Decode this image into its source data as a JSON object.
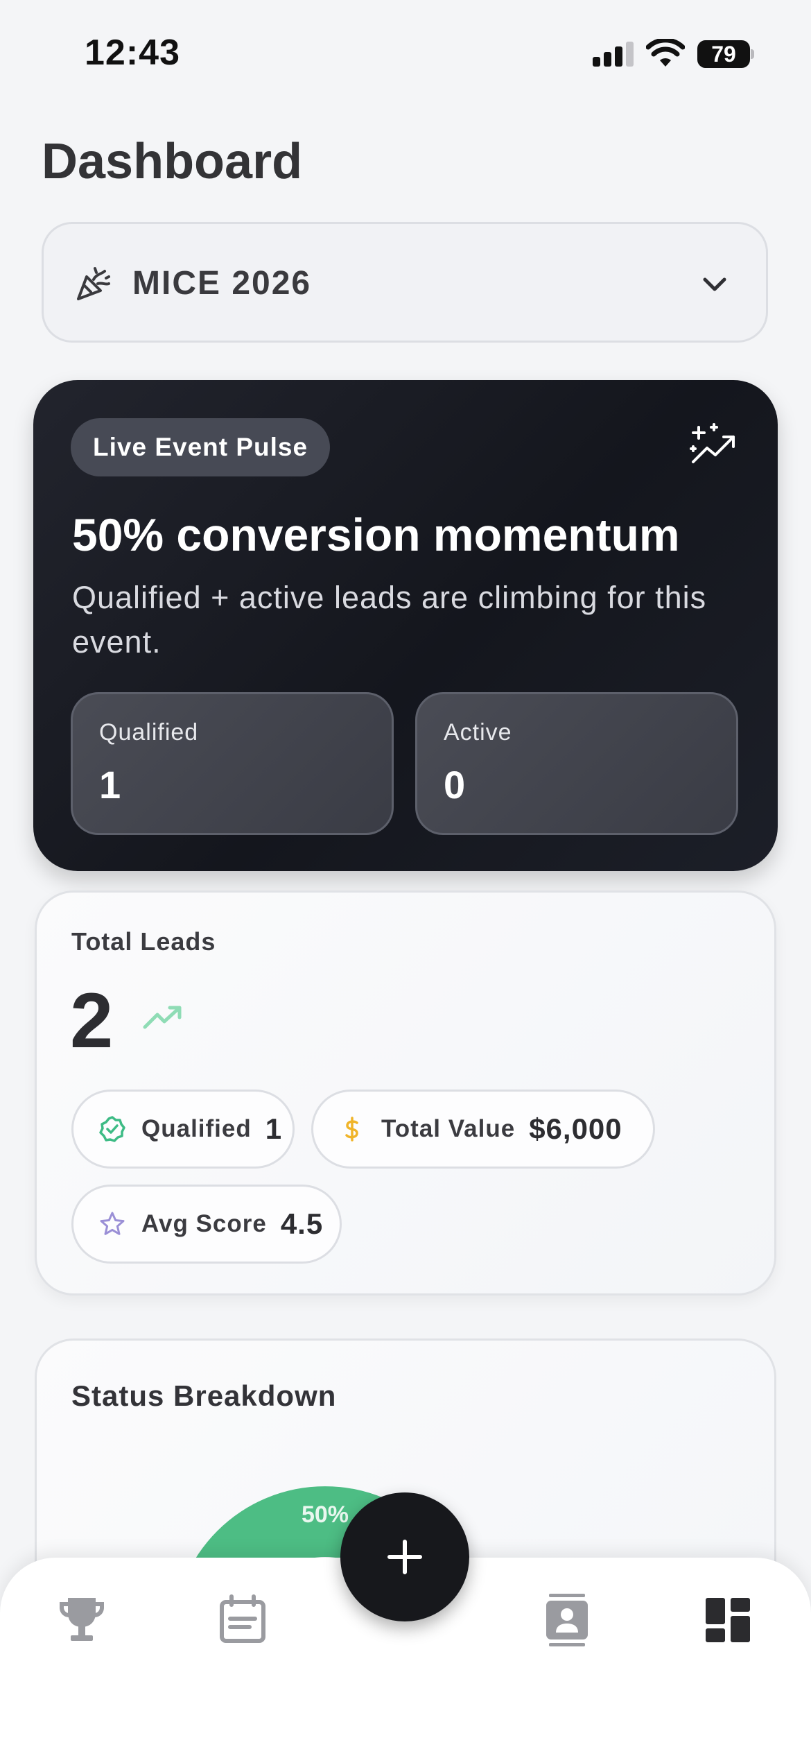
{
  "status_bar": {
    "time": "12:43",
    "battery": "79"
  },
  "page": {
    "title": "Dashboard"
  },
  "event_selector": {
    "value": "MICE 2026",
    "icon": "party-popper-icon"
  },
  "hero": {
    "badge": "Live Event Pulse",
    "headline": "50% conversion momentum",
    "subline": "Qualified + active leads are climbing for this event.",
    "stats": [
      {
        "label": "Qualified",
        "value": "1"
      },
      {
        "label": "Active",
        "value": "0"
      }
    ]
  },
  "leads": {
    "label": "Total Leads",
    "total": "2",
    "pills": [
      {
        "label": "Qualified",
        "value": "1",
        "icon": "verified-badge-icon",
        "color": "#3dbb85"
      },
      {
        "label": "Total Value",
        "value": "$6,000",
        "icon": "dollar-icon",
        "color": "#f0b429"
      },
      {
        "label": "Avg Score",
        "value": "4.5",
        "icon": "star-icon",
        "color": "#9a8fd6"
      }
    ]
  },
  "status_breakdown": {
    "title": "Status Breakdown",
    "chart_data": {
      "type": "pie",
      "values": [
        50
      ],
      "data_labels": [
        "50%"
      ],
      "colors": [
        "#4dbd84"
      ]
    }
  },
  "tab_bar": {
    "tabs": [
      {
        "icon": "trophy-icon",
        "active": false
      },
      {
        "icon": "calendar-icon",
        "active": false
      },
      {
        "icon": "contacts-icon",
        "active": false
      },
      {
        "icon": "dashboard-icon",
        "active": true
      }
    ],
    "fab_icon": "plus-icon"
  },
  "colors": {
    "accent_green": "#4dbd84",
    "hero_bg": "#171920",
    "tab_inactive": "#9a9ba0",
    "tab_active": "#2b2b2e"
  }
}
